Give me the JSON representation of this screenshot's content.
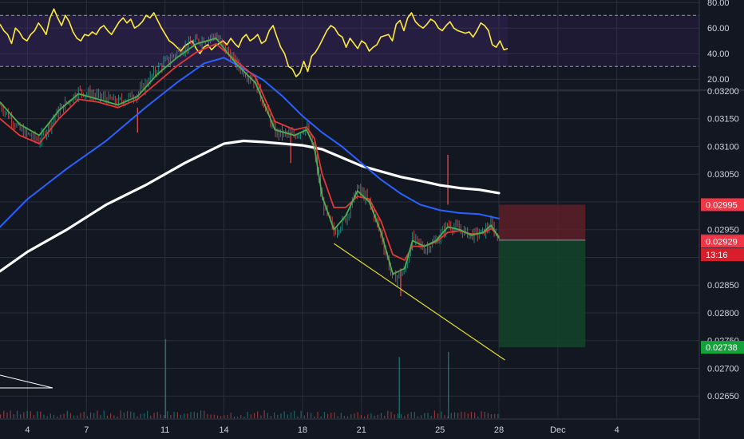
{
  "chart_data": [
    {
      "type": "line",
      "name": "oscillator",
      "ylim": [
        12,
        82
      ],
      "levels": [
        70,
        30
      ],
      "band": [
        30,
        70
      ],
      "y_ticks": [
        "80.00",
        "60.00",
        "40.00",
        "20.00"
      ],
      "y_tick_values": [
        80,
        60,
        40,
        20
      ],
      "series": [
        {
          "values": [
            63,
            58,
            55,
            48,
            60,
            57,
            52,
            50,
            55,
            58,
            64,
            60,
            55,
            68,
            75,
            68,
            62,
            70,
            65,
            57,
            52,
            50,
            55,
            54,
            57,
            55,
            60,
            62,
            58,
            55,
            60,
            65,
            68,
            64,
            67,
            60,
            62,
            65,
            70,
            68,
            72,
            66,
            60,
            55,
            50,
            48,
            45,
            42,
            46,
            48,
            50,
            44,
            40,
            45,
            47,
            43,
            46,
            48,
            50,
            47,
            52,
            48,
            45,
            52,
            55,
            50,
            52,
            55,
            48,
            50,
            58,
            62,
            53,
            45,
            40,
            30,
            28,
            22,
            25,
            34,
            26,
            38,
            41,
            46,
            52,
            58,
            62,
            60,
            55,
            53,
            45,
            52,
            48,
            44,
            50,
            48,
            42,
            45,
            47,
            53,
            54,
            55,
            50,
            63,
            66,
            58,
            68,
            72,
            65,
            62,
            60,
            63,
            67,
            65,
            60,
            58,
            62,
            65,
            60,
            58,
            57,
            56,
            57,
            53,
            58,
            64,
            62,
            58,
            47,
            45,
            50,
            43,
            44
          ]
        }
      ]
    },
    {
      "type": "candlestick",
      "name": "price",
      "ylim": [
        0.0261,
        0.032
      ],
      "y_ticks": [
        "0.03200",
        "0.03150",
        "0.03100",
        "0.03050",
        "0.03000",
        "0.02950",
        "0.02900",
        "0.02850",
        "0.02800",
        "0.02750",
        "0.02700",
        "0.02650"
      ],
      "y_tick_values": [
        0.032,
        0.0315,
        0.031,
        0.0305,
        0.03,
        0.0295,
        0.029,
        0.0285,
        0.028,
        0.0275,
        0.027,
        0.0265
      ],
      "x_ticks": [
        "4",
        "7",
        "11",
        "14",
        "18",
        "21",
        "25",
        "28",
        "Dec",
        "4"
      ],
      "x_tick_days": [
        4,
        7,
        11,
        14,
        18,
        21,
        25,
        28,
        31,
        34
      ],
      "xlim": [
        2.6,
        38.2
      ],
      "price": {
        "day": [
          2.6,
          3.6,
          4.6,
          5.6,
          6.6,
          7.6,
          8.6,
          9.6,
          10.6,
          11.6,
          12.6,
          13.6,
          14.6,
          15.6,
          16.6,
          17.6,
          18.2,
          18.6,
          19.0,
          19.6,
          20.2,
          20.8,
          21.4,
          22.0,
          22.6,
          23.2,
          23.6,
          24.2,
          24.8,
          25.4,
          26.0,
          26.6,
          27.2,
          27.6,
          28.0
        ],
        "close": [
          0.03175,
          0.0313,
          0.0311,
          0.03165,
          0.032,
          0.0319,
          0.0318,
          0.03195,
          0.0324,
          0.0327,
          0.0329,
          0.033,
          0.0325,
          0.03215,
          0.03125,
          0.0312,
          0.03135,
          0.0309,
          0.03,
          0.02945,
          0.0297,
          0.03025,
          0.03,
          0.0294,
          0.0286,
          0.02875,
          0.02935,
          0.02915,
          0.0293,
          0.0296,
          0.0295,
          0.0294,
          0.02945,
          0.0296,
          0.02931
        ]
      },
      "ema_green": {
        "day": [
          2.6,
          3.6,
          4.6,
          5.6,
          6.6,
          7.6,
          8.6,
          9.6,
          10.6,
          11.6,
          12.6,
          13.6,
          14.6,
          15.6,
          16.6,
          17.6,
          18.2,
          18.6,
          19.0,
          19.6,
          20.2,
          20.8,
          21.4,
          22.0,
          22.6,
          23.2,
          23.6,
          24.2,
          24.8,
          25.4,
          26.0,
          26.6,
          27.2,
          27.6,
          28.0
        ],
        "values": [
          0.0318,
          0.0314,
          0.0312,
          0.03165,
          0.03195,
          0.03185,
          0.03175,
          0.0319,
          0.0323,
          0.0326,
          0.03285,
          0.03295,
          0.0325,
          0.03215,
          0.0313,
          0.0312,
          0.0313,
          0.031,
          0.0301,
          0.0295,
          0.02975,
          0.0302,
          0.03,
          0.02945,
          0.0287,
          0.0288,
          0.0293,
          0.0292,
          0.0293,
          0.02955,
          0.0295,
          0.0294,
          0.02945,
          0.02958,
          0.02935
        ]
      },
      "ema_red": {
        "day": [
          2.6,
          3.6,
          4.6,
          5.6,
          6.6,
          7.6,
          8.6,
          9.6,
          10.6,
          11.6,
          12.6,
          13.6,
          14.6,
          15.6,
          16.6,
          17.6,
          18.2,
          18.6,
          19.0,
          19.6,
          20.2,
          20.8,
          21.4,
          22.0,
          22.6,
          23.2,
          23.6,
          24.2,
          24.8,
          25.4,
          26.0,
          26.6,
          27.2,
          27.6,
          28.0
        ],
        "values": [
          0.0315,
          0.0312,
          0.03105,
          0.0315,
          0.03185,
          0.0318,
          0.0317,
          0.03185,
          0.03215,
          0.03245,
          0.0327,
          0.03285,
          0.03255,
          0.03225,
          0.03145,
          0.0313,
          0.03135,
          0.03115,
          0.0305,
          0.0299,
          0.0299,
          0.0301,
          0.03005,
          0.02965,
          0.02905,
          0.02895,
          0.0292,
          0.0292,
          0.02928,
          0.02945,
          0.02948,
          0.02942,
          0.02944,
          0.02952,
          0.02938
        ]
      },
      "ma_blue": {
        "day": [
          2.6,
          4.0,
          6.0,
          8.0,
          10.0,
          11.6,
          13.0,
          14.0,
          15.0,
          16.0,
          17.0,
          18.0,
          19.0,
          20.0,
          21.0,
          22.0,
          23.0,
          24.0,
          25.0,
          26.0,
          27.0,
          28.0
        ],
        "values": [
          0.02955,
          0.03005,
          0.0306,
          0.0311,
          0.0317,
          0.03215,
          0.0325,
          0.0326,
          0.0324,
          0.0322,
          0.0319,
          0.03155,
          0.03125,
          0.031,
          0.0307,
          0.0304,
          0.03015,
          0.02995,
          0.02985,
          0.0298,
          0.02978,
          0.0297
        ]
      },
      "ma_white": {
        "day": [
          2.6,
          4.0,
          6.0,
          8.0,
          10.0,
          12.0,
          14.0,
          15.0,
          16.0,
          17.0,
          18.0,
          19.0,
          20.0,
          21.0,
          22.0,
          23.0,
          24.0,
          25.0,
          26.0,
          27.0,
          28.0
        ],
        "values": [
          0.02875,
          0.0291,
          0.0295,
          0.02995,
          0.0303,
          0.0307,
          0.03105,
          0.0311,
          0.03108,
          0.03105,
          0.03102,
          0.03095,
          0.0308,
          0.03065,
          0.03055,
          0.03045,
          0.03038,
          0.0303,
          0.03025,
          0.03022,
          0.03016
        ]
      },
      "trendline": {
        "day": [
          19.6,
          28.3
        ],
        "values": [
          0.02925,
          0.02715
        ]
      },
      "position": {
        "day_start": 28.0,
        "day_end": 32.4,
        "entry": 0.02931,
        "stop": 0.02995,
        "target": 0.02738,
        "stop_color": "#5d1e28",
        "target_color": "#12442a"
      },
      "price_labels": [
        {
          "text": "0.02995",
          "value": 0.02995,
          "color": "#f23645"
        },
        {
          "text": "0.02931",
          "value": 0.02931,
          "color": "#2f3342"
        },
        {
          "text": "0.02929",
          "value": 0.02929,
          "color": "#f23645"
        },
        {
          "text": "13:16",
          "value": 0.02905,
          "color": "#d81e2a"
        },
        {
          "text": "0.02738",
          "value": 0.02738,
          "color": "#12a33b"
        }
      ],
      "volume": {
        "spike_days": [
          11.0,
          22.9,
          25.4
        ],
        "spike_heights": [
          0.62,
          0.48,
          0.52
        ]
      }
    }
  ],
  "colors": {
    "background": "#131722",
    "grid": "#2a2e39",
    "rsi_line": "#ffeb3b",
    "rsi_band": "#4a2a7c",
    "ema_green": "#4caf50",
    "ema_red": "#e53935",
    "ma_blue": "#2962ff",
    "ma_white": "#ffffff",
    "trendline": "#e6de2a",
    "candle_up": "#26a69a",
    "candle_down": "#ef5350"
  }
}
